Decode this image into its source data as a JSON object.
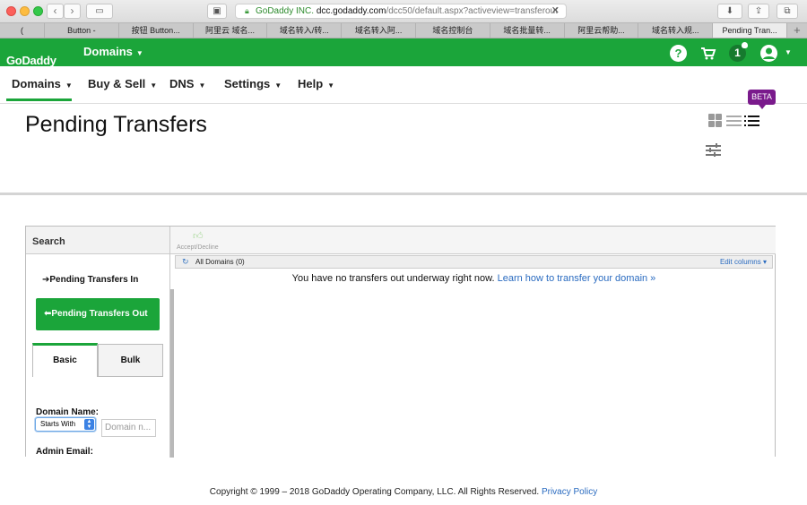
{
  "browser": {
    "url_org": "GoDaddy INC.",
    "url_host": "dcc.godaddy.com",
    "url_path": "/dcc50/default.aspx?activeview=transferout",
    "tabs": [
      {
        "label": "("
      },
      {
        "label": "Button -"
      },
      {
        "label": "按钮 Button..."
      },
      {
        "label": "阿里云 域名..."
      },
      {
        "label": "域名转入/转..."
      },
      {
        "label": "域名转入阿..."
      },
      {
        "label": "域名控制台"
      },
      {
        "label": "域名批量转..."
      },
      {
        "label": "阿里云帮助..."
      },
      {
        "label": "域名转入规..."
      },
      {
        "label": "Pending Tran..."
      }
    ]
  },
  "header": {
    "logo": "GoDaddy",
    "product_menu": "Domains",
    "help_label": "?",
    "notification_count": "1"
  },
  "subnav": {
    "items": [
      "Domains",
      "Buy & Sell",
      "DNS",
      "Settings",
      "Help"
    ]
  },
  "page": {
    "title": "Pending Transfers",
    "beta_badge": "BETA"
  },
  "sidebar": {
    "search_heading": "Search",
    "pending_in": "Pending Transfers In",
    "pending_out": "Pending Transfers Out",
    "tab_basic": "Basic",
    "tab_bulk": "Bulk",
    "domain_name_label": "Domain Name:",
    "match_select_value": "Starts With",
    "domain_input_placeholder": "Domain n...",
    "admin_email_label": "Admin Email:"
  },
  "grid": {
    "toolbar_action": "Accept/Decline",
    "filter_label": "All Domains (0)",
    "edit_columns": "Edit columns",
    "empty_message": "You have no transfers out underway right now.",
    "empty_link": "Learn how to transfer your domain »"
  },
  "footer": {
    "copyright": "Copyright © 1999 – 2018 GoDaddy Operating Company, LLC. All Rights Reserved.",
    "privacy_link": "Privacy Policy"
  },
  "colors": {
    "brand_green": "#1ba53a",
    "beta_purple": "#7a1a8c",
    "link_blue": "#2a6bc0"
  }
}
